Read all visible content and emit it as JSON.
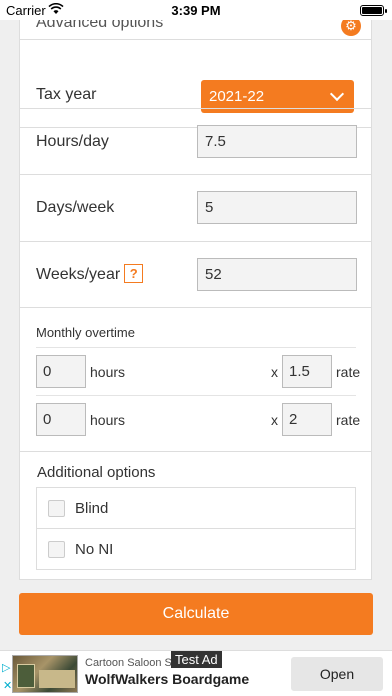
{
  "status_bar": {
    "carrier": "Carrier",
    "time": "3:39 PM"
  },
  "colors": {
    "accent": "#f47b20"
  },
  "advanced": {
    "label": "Advanced options",
    "icon": "gear-icon"
  },
  "tax_year": {
    "label": "Tax year",
    "value": "2021-22"
  },
  "hours_day": {
    "label": "Hours/day",
    "value": "7.5"
  },
  "days_week": {
    "label": "Days/week",
    "value": "5"
  },
  "weeks_year": {
    "label": "Weeks/year",
    "help": "?",
    "value": "52"
  },
  "overtime": {
    "label": "Monthly overtime",
    "rows": [
      {
        "hours": "0",
        "hours_label": "hours",
        "x": "x",
        "rate": "1.5",
        "rate_label": "rate"
      },
      {
        "hours": "0",
        "hours_label": "hours",
        "x": "x",
        "rate": "2",
        "rate_label": "rate"
      }
    ]
  },
  "additional": {
    "label": "Additional options",
    "options": [
      {
        "label": "Blind",
        "checked": false
      },
      {
        "label": "No NI",
        "checked": false
      }
    ]
  },
  "calculate": {
    "label": "Calculate"
  },
  "ad": {
    "sponsor": "Cartoon Saloon Store",
    "test_tag": "Test Ad",
    "title": "WolfWalkers Boardgame",
    "cta": "Open"
  }
}
